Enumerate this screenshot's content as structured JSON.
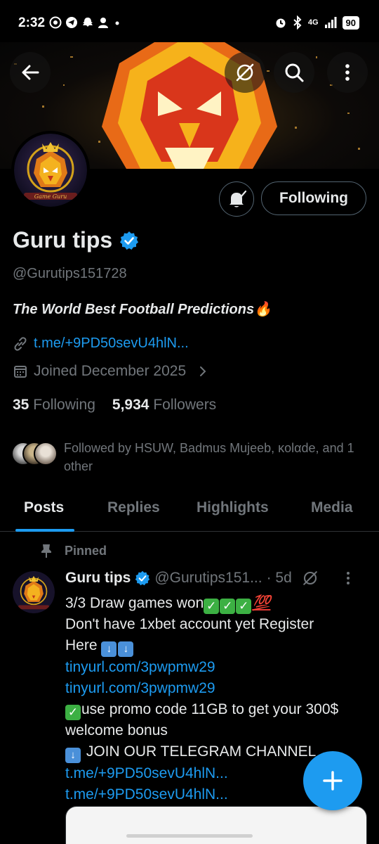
{
  "status_bar": {
    "time": "2:32",
    "network": "4G",
    "battery": "90"
  },
  "profile": {
    "display_name": "Guru tips",
    "handle": "@Gurutips151728",
    "bio": "The World Best Football Predictions🔥",
    "link": "t.me/+9PD50sevU4hlN...",
    "joined": "Joined December 2025",
    "following_count": "35",
    "following_label": "Following",
    "followers_count": "5,934",
    "followers_label": "Followers",
    "followed_by": "Followed by HSUW, Badmus Mujeeb, κolαde, and 1 other",
    "avatar_text": "Game Guru"
  },
  "actions": {
    "following_button": "Following"
  },
  "tabs": [
    {
      "label": "Posts",
      "active": true
    },
    {
      "label": "Replies",
      "active": false
    },
    {
      "label": "Highlights",
      "active": false
    },
    {
      "label": "Media",
      "active": false
    }
  ],
  "pinned_post": {
    "pinned_label": "Pinned",
    "author_name": "Guru tips",
    "author_handle": "@Gurutips151...",
    "time": "· 5d",
    "line1_text": "3/3 Draw games won",
    "line1_emoji": "💯",
    "line2": "Don't have 1xbet account yet Register",
    "line3_text": "Here",
    "link1": "tinyurl.com/3pwpmw29",
    "link2": "tinyurl.com/3pwpmw29",
    "line6_text": "use promo code 11GB to get your 300$",
    "line7": "welcome bonus",
    "line8_text": "JOIN OUR TELEGRAM CHANNEL",
    "link3": "t.me/+9PD50sevU4hlN...",
    "link4": "t.me/+9PD50sevU4hlN..."
  },
  "colors": {
    "accent": "#1d9bf0",
    "muted": "#71767b",
    "background": "#000000",
    "text": "#e7e9ea"
  },
  "icons": [
    "back-arrow-icon",
    "grok-icon",
    "search-icon",
    "more-vertical-icon",
    "bell-icon",
    "verified-badge-icon",
    "link-icon",
    "calendar-icon",
    "chevron-right-icon",
    "pin-icon",
    "compose-plus-icon"
  ]
}
